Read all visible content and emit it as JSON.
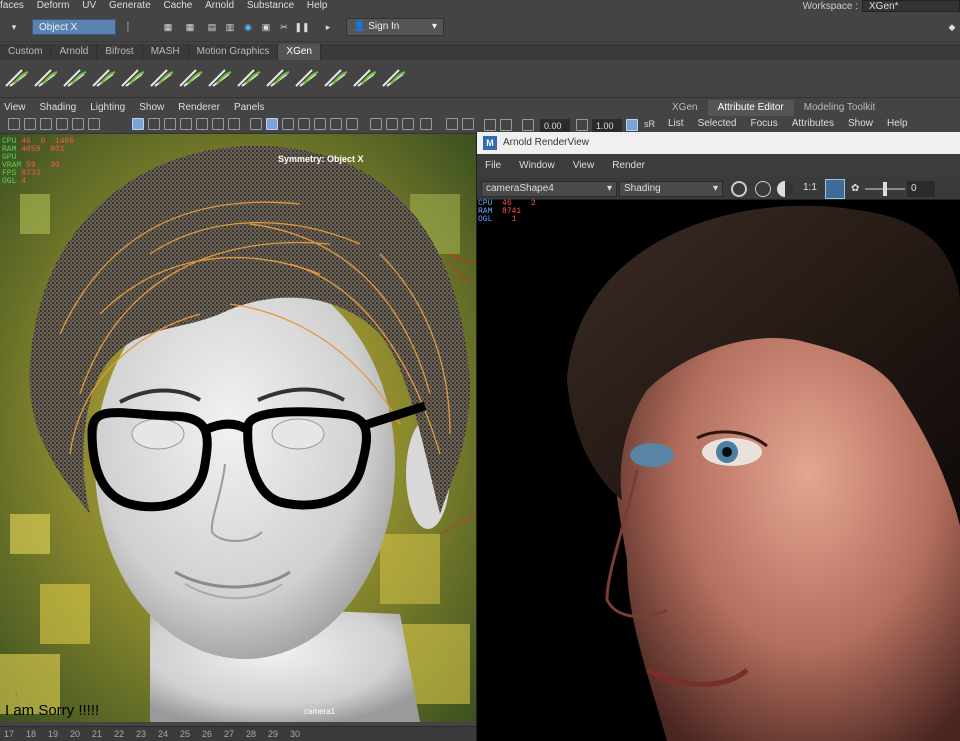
{
  "menubar": {
    "items": [
      "faces",
      "Deform",
      "UV",
      "Generate",
      "Cache",
      "Arnold",
      "Substance",
      "Help"
    ],
    "workspace_label": "Workspace :",
    "workspace_value": "XGen*"
  },
  "statusline": {
    "object_field": "Object X",
    "sign_in": "Sign In"
  },
  "shelf": {
    "tabs": [
      "Custom",
      "Arnold",
      "Bifrost",
      "MASH",
      "Motion Graphics",
      "XGen"
    ],
    "active_tab": "XGen"
  },
  "viewport": {
    "menu": [
      "View",
      "Shading",
      "Lighting",
      "Show",
      "Renderer",
      "Panels"
    ],
    "field_a": "0.00",
    "field_b": "1.00",
    "srgb": "sR",
    "symmetry": "Symmetry: Object X",
    "camera": "camera1",
    "overlay_text": "I am Sorry !!!!!",
    "hud": [
      {
        "label": "CPU",
        "v1": "46",
        "v2": "0"
      },
      {
        "label": "RAM",
        "v1": "4059",
        "v2": "801"
      },
      {
        "label": "GPU",
        "v1": "",
        "v2": ""
      },
      {
        "label": "VRAM",
        "v1": "59",
        "v2": "30"
      },
      {
        "label": "FPS",
        "v1": "8733",
        "v2": ""
      },
      {
        "label": "OGL",
        "v1": "4",
        "v2": ""
      }
    ],
    "hud_extra": "1465"
  },
  "right_panel": {
    "tabs": [
      "XGen",
      "Attribute Editor",
      "Modeling Toolkit"
    ],
    "active_tab": "Attribute Editor",
    "menu": [
      "List",
      "Selected",
      "Focus",
      "Attributes",
      "Show",
      "Help"
    ]
  },
  "arnold": {
    "title": "Arnold RenderView",
    "logo": "M",
    "menu": [
      "File",
      "Window",
      "View",
      "Render"
    ],
    "camera": "cameraShape4",
    "shading": "Shading",
    "ratio": "1:1",
    "slider_value": "0",
    "hud": [
      {
        "label": "CPU",
        "v1": "46",
        "v2": "2"
      },
      {
        "label": "RAM",
        "v1": "8741",
        "v2": ""
      },
      {
        "label": "OGL",
        "v1": "1",
        "v2": ""
      }
    ]
  },
  "timeline": {
    "ticks": [
      "17",
      "18",
      "19",
      "20",
      "21",
      "22",
      "23",
      "24",
      "25",
      "26",
      "27",
      "28",
      "29",
      "30"
    ]
  },
  "colors": {
    "accent": "#5a83b0",
    "hud_label": "#56d35a",
    "hud_value": "#ff5555"
  }
}
